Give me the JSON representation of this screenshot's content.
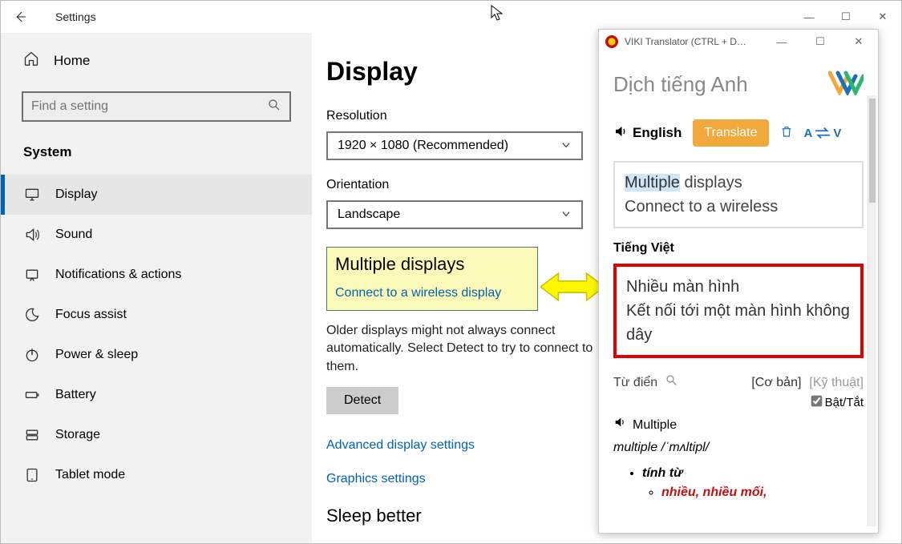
{
  "window": {
    "title": "Settings",
    "controls": {
      "min": "—",
      "max": "☐",
      "close": "✕"
    }
  },
  "sidebar": {
    "home_label": "Home",
    "search_placeholder": "Find a setting",
    "system_label": "System",
    "items": [
      {
        "label": "Display",
        "icon": "monitor",
        "active": true
      },
      {
        "label": "Sound",
        "icon": "sound"
      },
      {
        "label": "Notifications & actions",
        "icon": "notifications"
      },
      {
        "label": "Focus assist",
        "icon": "moon"
      },
      {
        "label": "Power & sleep",
        "icon": "power"
      },
      {
        "label": "Battery",
        "icon": "battery"
      },
      {
        "label": "Storage",
        "icon": "storage"
      },
      {
        "label": "Tablet mode",
        "icon": "tablet"
      }
    ]
  },
  "content": {
    "page_title": "Display",
    "resolution_label": "Resolution",
    "resolution_value": "1920 × 1080 (Recommended)",
    "orientation_label": "Orientation",
    "orientation_value": "Landscape",
    "multi_head": "Multiple displays",
    "multi_link": "Connect to a wireless display",
    "older_text": "Older displays might not always connect automatically. Select Detect to try to connect to them.",
    "detect_label": "Detect",
    "adv_link": "Advanced display settings",
    "gfx_link": "Graphics settings",
    "sleep_head": "Sleep better"
  },
  "viki": {
    "titlebar": "VIKI Translator (CTRL + D…",
    "header_title": "Dịch tiếng Anh",
    "english_label": "English",
    "translate_label": "Translate",
    "swap_a": "A",
    "swap_v": "V",
    "input_line1_sel": "Multiple",
    "input_line1_rest": " displays",
    "input_line2": "Connect to a wireless",
    "out_label": "Tiếng Việt",
    "out_line1": "Nhiều màn hình",
    "out_line2": "Kết nối tới một màn hình không dây",
    "dict_label": "Từ điển",
    "tab_basic": "[Cơ bản]",
    "tab_tech": "[Kỹ thuật]",
    "toggle_label": "Bật/Tắt",
    "dict_word": "Multiple",
    "dict_ipa": "multiple /ˈmʌltipl/",
    "dict_pos": "tính từ",
    "dict_def": "nhiều, nhiều mối,"
  }
}
